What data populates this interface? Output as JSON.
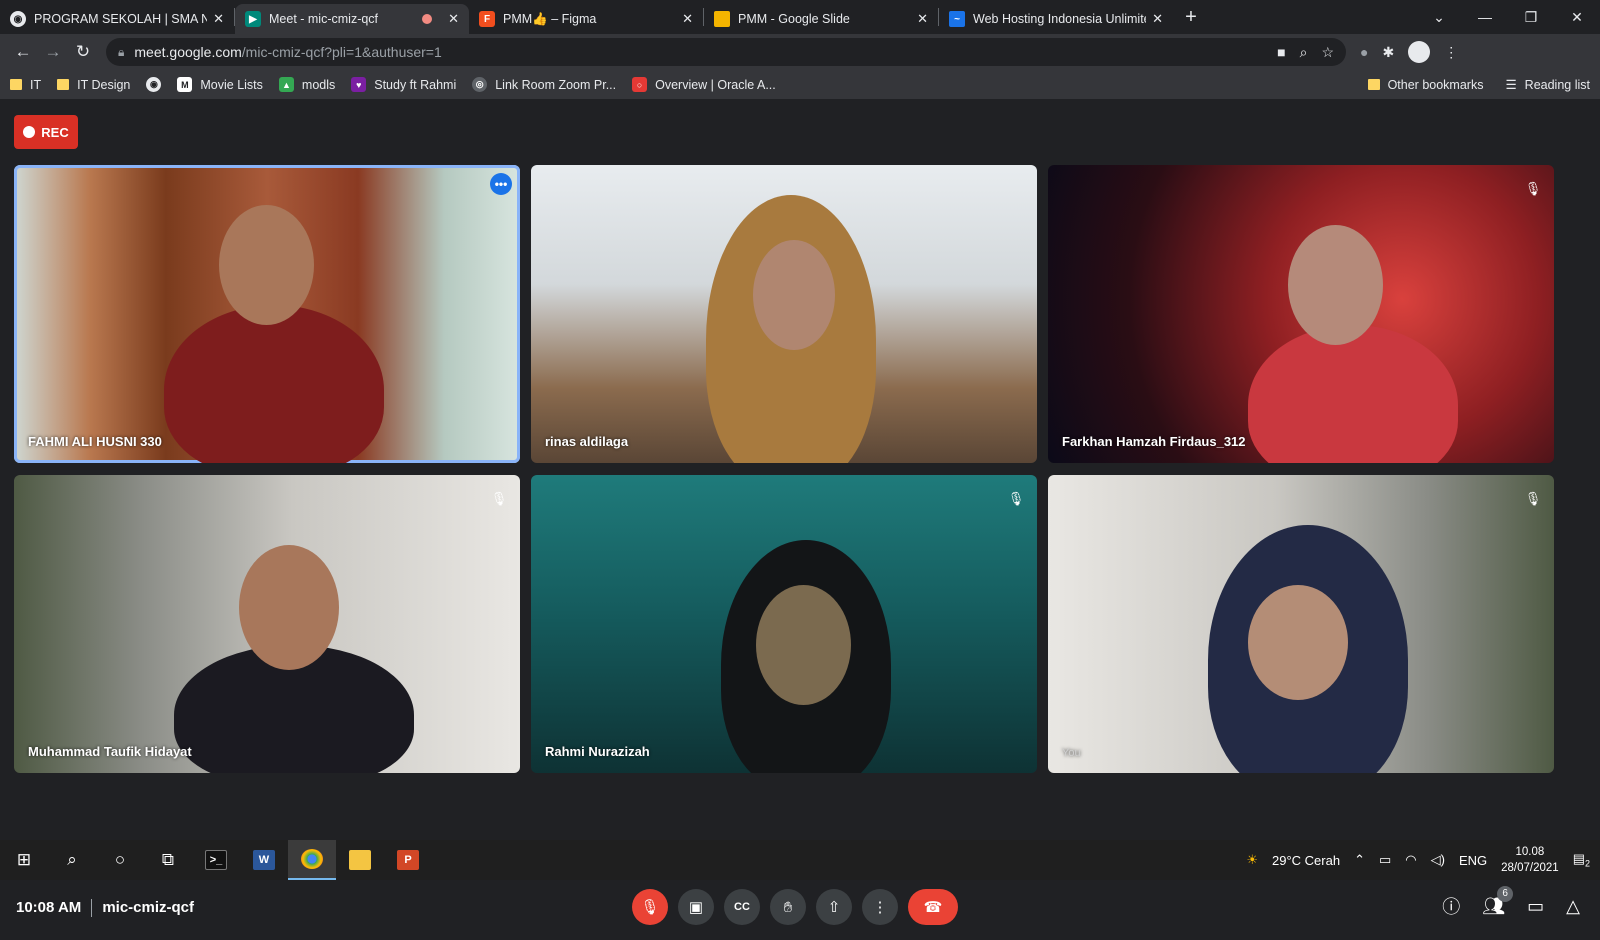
{
  "browser": {
    "tabs": [
      {
        "title": "PROGRAM SEKOLAH | SMA NEGE",
        "icon": "globe-icon",
        "color": "#e8eaed",
        "active": false
      },
      {
        "title": "Meet - mic-cmiz-qcf",
        "icon": "meet-icon",
        "color": "#00897b",
        "active": true
      },
      {
        "title": "PMM👍 – Figma",
        "icon": "figma-icon",
        "color": "#f24e1e",
        "active": false
      },
      {
        "title": "PMM - Google Slide",
        "icon": "slides-icon",
        "color": "#f4b400",
        "active": false
      },
      {
        "title": "Web Hosting Indonesia Unlimite",
        "icon": "hosting-icon",
        "color": "#1a73e8",
        "active": false
      }
    ],
    "url_host": "meet.google.com",
    "url_path": "/mic-cmiz-qcf?pli=1&authuser=1",
    "bookmarks": [
      {
        "label": "IT",
        "type": "folder"
      },
      {
        "label": "IT Design",
        "type": "folder"
      },
      {
        "label": "",
        "type": "site",
        "icon": "globe-icon",
        "color": "#5f6368"
      },
      {
        "label": "Movie Lists",
        "type": "site",
        "icon": "M",
        "color": "#ffffff"
      },
      {
        "label": "modls",
        "type": "site",
        "icon": "drive-icon",
        "color": "#34a853"
      },
      {
        "label": "Study ft Rahmi",
        "type": "site",
        "icon": "site-icon",
        "color": "#7b1fa2"
      },
      {
        "label": "Link Room Zoom Pr...",
        "type": "site",
        "icon": "site-icon",
        "color": "#5f6368"
      },
      {
        "label": "Overview | Oracle A...",
        "type": "site",
        "icon": "oracle-icon",
        "color": "#e53935"
      }
    ],
    "other_bookmarks": "Other bookmarks",
    "reading_list": "Reading list"
  },
  "meet": {
    "rec_label": "REC",
    "participants": [
      {
        "name": "FAHMI ALI HUSNI 330",
        "muted": false,
        "active": true
      },
      {
        "name": "rinas aldilaga",
        "muted": false,
        "active": false
      },
      {
        "name": "Farkhan Hamzah Firdaus_312",
        "muted": true,
        "active": false
      },
      {
        "name": "Muhammad Taufik Hidayat",
        "muted": true,
        "active": false
      },
      {
        "name": "Rahmi Nurazizah",
        "muted": true,
        "active": false
      },
      {
        "name": "You",
        "muted": true,
        "active": false
      }
    ],
    "time": "10:08 AM",
    "meeting_code": "mic-cmiz-qcf",
    "people_count": "6"
  },
  "taskbar": {
    "weather": "29°C  Cerah",
    "language": "ENG",
    "clock_time": "10.08",
    "clock_date": "28/07/2021",
    "notifications": "2"
  }
}
